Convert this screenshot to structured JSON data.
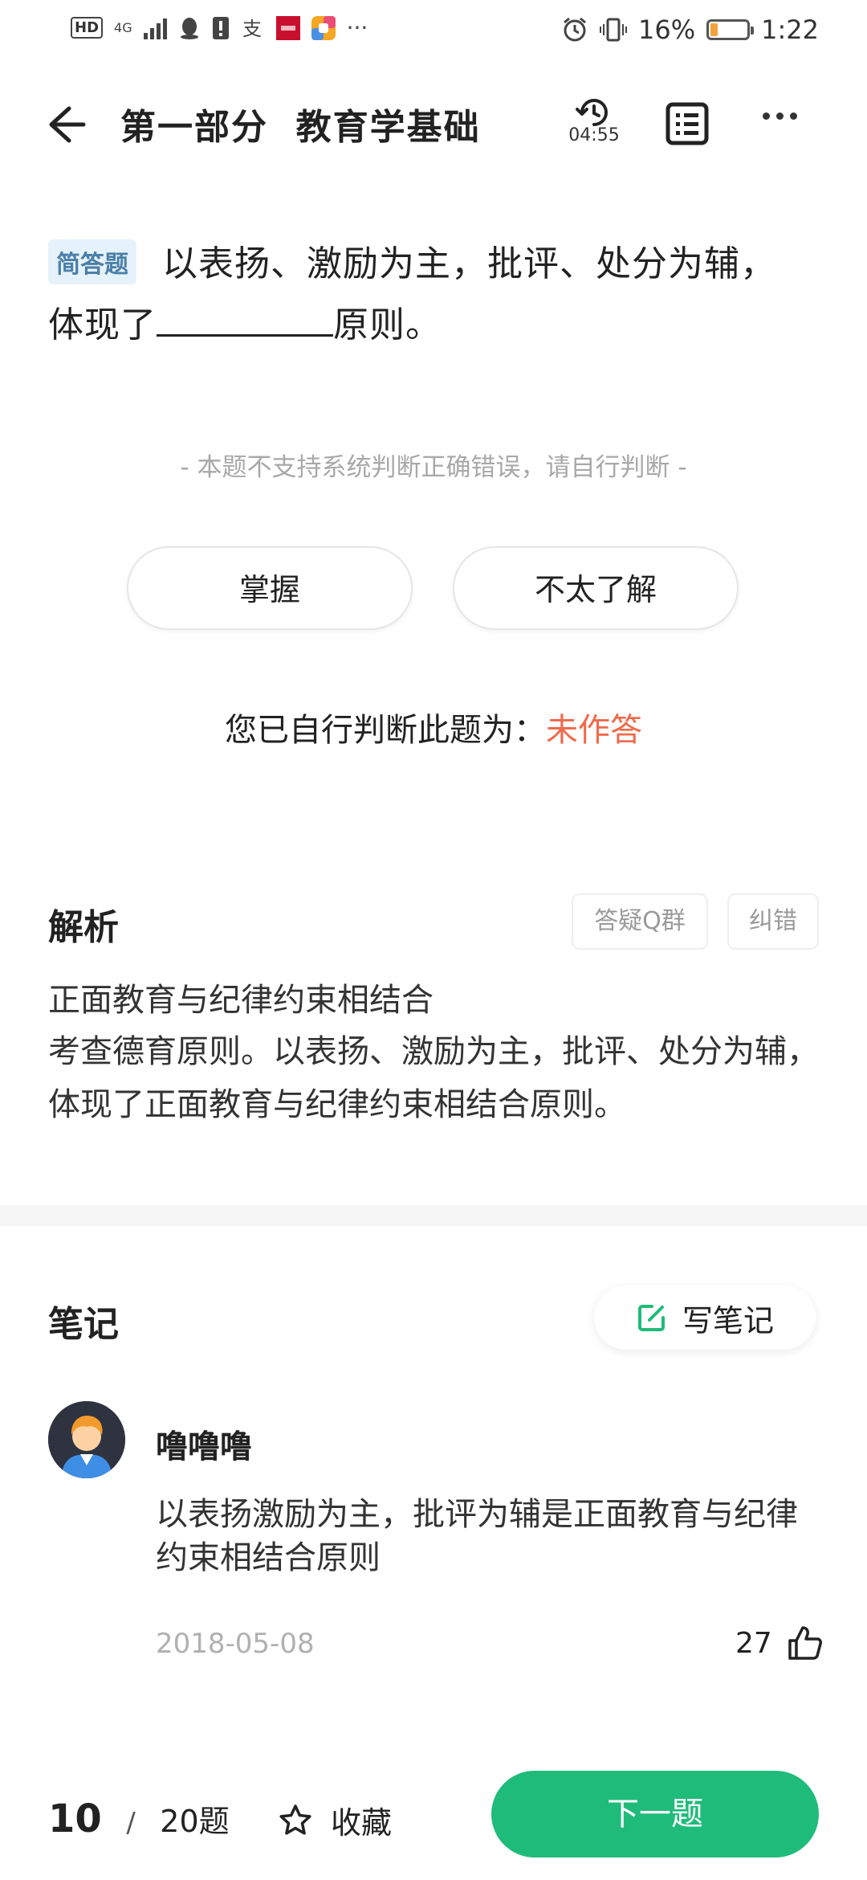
{
  "status_bar": {
    "hd": "HD",
    "network": "4G",
    "battery": "16%",
    "time": "1:22",
    "battery_level": 0.16
  },
  "header": {
    "title": "第一部分  教育学基础",
    "timer": "04:55"
  },
  "question": {
    "type_tag": "简答题",
    "line1": "以表扬、激励为主，批评、处分为辅，",
    "line2_prefix": "体现了",
    "line2_suffix": "原则。",
    "notice": "- 本题不支持系统判断正确错误，请自行判断 -"
  },
  "judge": {
    "mastered": "掌握",
    "not_understood": "不太了解",
    "self_judge_label": "您已自行判断此题为：",
    "self_judge_state": "未作答",
    "state_color": "#f06a4a"
  },
  "analysis": {
    "title": "解析",
    "qq_group": "答疑Q群",
    "correct": "纠错",
    "answer": "正面教育与纪律约束相结合",
    "explanation": "考查德育原则。以表扬、激励为主，批评、处分为辅，体现了正面教育与纪律约束相结合原则。"
  },
  "notes": {
    "title": "笔记",
    "write_label": "写笔记",
    "items": [
      {
        "user": "噜噜噜",
        "text": "以表扬激励为主，批评为辅是正面教育与纪律约束相结合原则",
        "date": "2018-05-08",
        "likes": "27"
      }
    ]
  },
  "footer": {
    "current": "10",
    "separator": "/",
    "total": "20题",
    "favorite": "收藏",
    "next": "下一题",
    "accent": "#1fbb7a"
  }
}
